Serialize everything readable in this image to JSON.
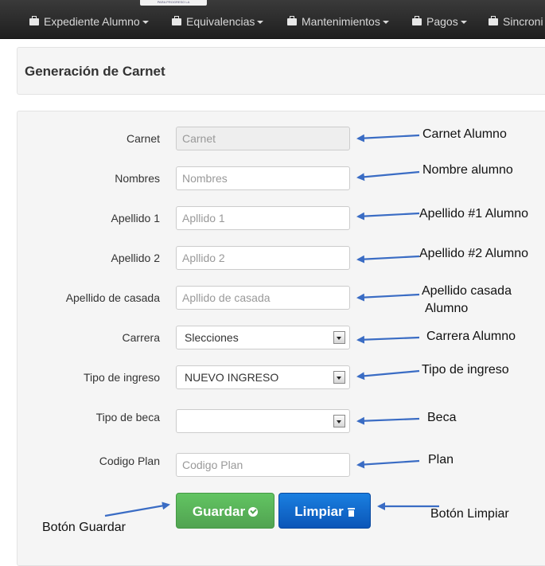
{
  "logo_text": "PARA PROGRESO LA",
  "nav": {
    "items": [
      {
        "label": "Expediente Alumno"
      },
      {
        "label": "Equivalencias"
      },
      {
        "label": "Mantenimientos"
      },
      {
        "label": "Pagos"
      },
      {
        "label": "Sincroni"
      }
    ]
  },
  "page": {
    "title": "Generación de Carnet"
  },
  "form": {
    "carnet": {
      "label": "Carnet",
      "placeholder": "Carnet"
    },
    "nombres": {
      "label": "Nombres",
      "placeholder": "Nombres"
    },
    "apellido1": {
      "label": "Apellido 1",
      "placeholder": "Apllido 1"
    },
    "apellido2": {
      "label": "Apellido 2",
      "placeholder": "Apllido 2"
    },
    "apellido_casada": {
      "label": "Apellido de casada",
      "placeholder": "Apllido de casada"
    },
    "carrera": {
      "label": "Carrera",
      "value": "Slecciones"
    },
    "tipo_ingreso": {
      "label": "Tipo de ingreso",
      "value": "NUEVO INGRESO"
    },
    "tipo_beca": {
      "label": "Tipo de beca",
      "value": ""
    },
    "codigo_plan": {
      "label": "Codigo Plan",
      "placeholder": "Codigo Plan"
    },
    "guardar_label": "Guardar",
    "limpiar_label": "Limpiar"
  },
  "annotations": {
    "carnet": "Carnet Alumno",
    "nombre": "Nombre alumno",
    "apellido1": "Apellido #1 Alumno",
    "apellido2": "Apellido #2 Alumno",
    "casada_line1": "Apellido casada",
    "casada_line2": "Alumno",
    "carrera": "Carrera Alumno",
    "tipo_ingreso": "Tipo de ingreso",
    "beca": "Beca",
    "plan": "Plan",
    "guardar": "Botón Guardar",
    "limpiar": "Botón Limpiar"
  },
  "colors": {
    "navbar": "#2b2b2b",
    "guardar": "#51a351",
    "limpiar": "#0b56b8",
    "arrow": "#3a6cc4"
  }
}
